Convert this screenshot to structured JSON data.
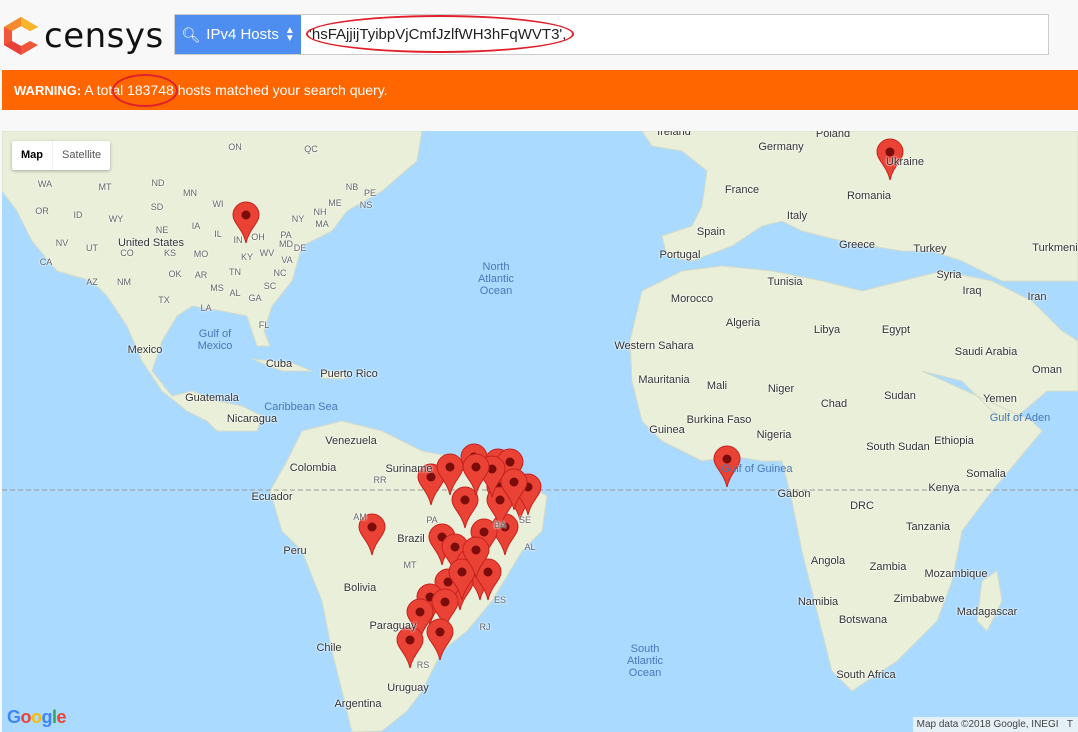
{
  "header": {
    "logo_text": "censys",
    "search_type": "IPv4 Hosts",
    "query": "'hsFAjjijTyibpVjCmfJzlfWH3hFqWVT3',"
  },
  "warning": {
    "label": "WARNING:",
    "pre": "A total",
    "count": "183748",
    "post": "hosts matched your search query."
  },
  "map": {
    "type_buttons": [
      "Map",
      "Satellite"
    ],
    "google": "Google",
    "attribution": "Map data ©2018 Google, INEGI",
    "attribution_more": "T",
    "countries": [
      "Ireland",
      "Poland",
      "Germany",
      "Ukraine",
      "France",
      "Romania",
      "Italy",
      "Spain",
      "Greece",
      "Turkey",
      "Turkmeni",
      "Portugal",
      "Syria",
      "Iraq",
      "Iran",
      "Morocco",
      "Tunisia",
      "Algeria",
      "Libya",
      "Egypt",
      "Saudi Arabia",
      "Western\nSahara",
      "Mauritania",
      "Mali",
      "Niger",
      "Chad",
      "Sudan",
      "Oman",
      "Yemen",
      "Burkina\nFaso",
      "Nigeria",
      "Ethiopia",
      "South Sudan",
      "Guinea",
      "Somalia",
      "Gabon",
      "Kenya",
      "DRC",
      "Tanzania",
      "Angola",
      "Zambia",
      "Mozambique",
      "Namibia",
      "Zimbabwe",
      "Madagascar",
      "Botswana",
      "South Africa",
      "Mexico",
      "United States",
      "Cuba",
      "Puerto Rico",
      "Guatemala",
      "Nicaragua",
      "Venezuela",
      "Colombia",
      "Suriname",
      "Ecuador",
      "Peru",
      "Brazil",
      "Bolivia",
      "Paraguay",
      "Chile",
      "Uruguay",
      "Argentina"
    ],
    "seas": [
      "North\nAtlantic\nOcean",
      "South\nAtlantic\nOcean",
      "Gulf of\nMexico",
      "Caribbean Sea",
      "Gulf of Guinea",
      "Gulf of Aden"
    ],
    "states": [
      "WA",
      "MT",
      "ND",
      "MN",
      "OR",
      "ID",
      "SD",
      "WI",
      "WY",
      "NE",
      "IA",
      "NV",
      "UT",
      "CO",
      "KS",
      "IL",
      "MO",
      "CA",
      "AZ",
      "NM",
      "OK",
      "AR",
      "TN",
      "NC",
      "SC",
      "GA",
      "AL",
      "MS",
      "LA",
      "TX",
      "FL",
      "KY",
      "WV",
      "VA",
      "OH",
      "IN",
      "PA",
      "NY",
      "MD",
      "DE",
      "NH",
      "MA",
      "ME",
      "NB",
      "PE",
      "NS",
      "ON",
      "QC",
      "AM",
      "PA",
      "MT",
      "RR",
      "BA",
      "SE",
      "AL",
      "ES",
      "RJ",
      "RS"
    ],
    "marker_count": 33,
    "marker_color": "#ea4335"
  }
}
